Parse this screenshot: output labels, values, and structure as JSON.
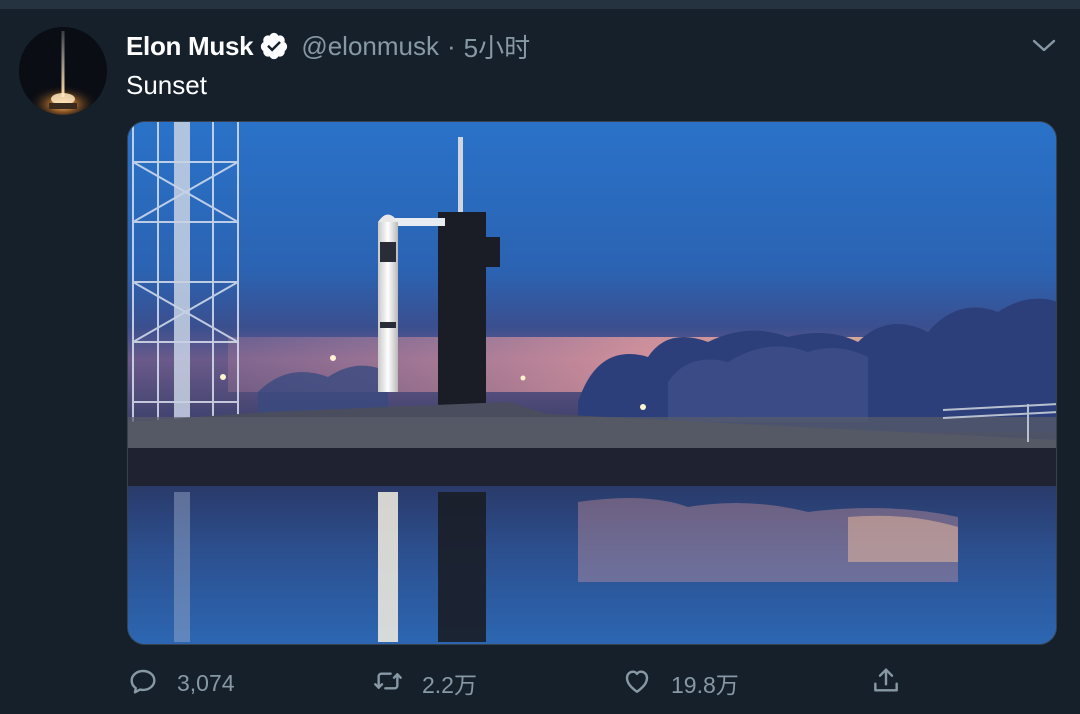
{
  "tweet": {
    "author_name": "Elon Musk",
    "handle": "@elonmusk",
    "separator": "·",
    "time": "5小时",
    "text": "Sunset",
    "verified_icon": "verified-badge-icon",
    "menu_icon": "chevron-down-icon",
    "media_description_icon": "photo"
  },
  "actions": {
    "reply": {
      "icon": "reply-bubble-icon",
      "count": "3,074"
    },
    "retweet": {
      "icon": "retweet-icon",
      "count": "2.2万"
    },
    "like": {
      "icon": "heart-icon",
      "count": "19.8万"
    },
    "share": {
      "icon": "share-upload-icon"
    }
  },
  "colors": {
    "background": "#15202b",
    "secondary_text": "#8899a6",
    "primary_text": "#ffffff"
  }
}
